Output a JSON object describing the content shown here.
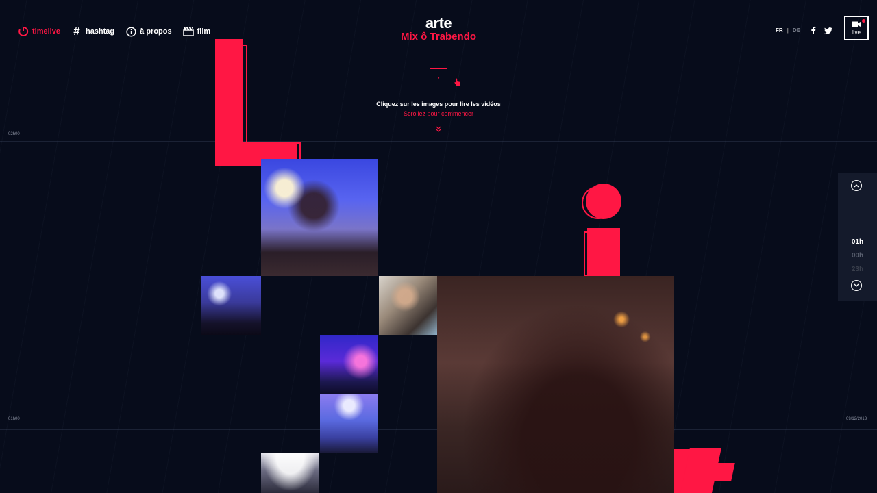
{
  "nav": {
    "items": [
      {
        "label": "timelive",
        "icon": "timelive-icon",
        "active": true
      },
      {
        "label": "hashtag",
        "icon": "hashtag-icon",
        "active": false
      },
      {
        "label": "à propos",
        "icon": "info-icon",
        "active": false
      },
      {
        "label": "film",
        "icon": "clapperboard-icon",
        "active": false
      }
    ]
  },
  "logo": {
    "brand": "arte",
    "subtitle": "Mix ô Trabendo"
  },
  "lang": {
    "fr": "FR",
    "separator": "|",
    "de": "DE"
  },
  "live": {
    "label": "live"
  },
  "intro": {
    "play_symbol": "›",
    "hint": "Cliquez sur les images pour lire les vidéos",
    "scroll_hint": "Scrollez pour commencer",
    "scroll_symbol": "˅"
  },
  "timeline": {
    "top_time": "02h00",
    "bottom_time": "01h00",
    "date": "09/12/2013",
    "hours": [
      "01h",
      "00h",
      "23h"
    ]
  },
  "colors": {
    "accent": "#ff1744",
    "background": "#070c1b",
    "panel": "#141a2b"
  }
}
